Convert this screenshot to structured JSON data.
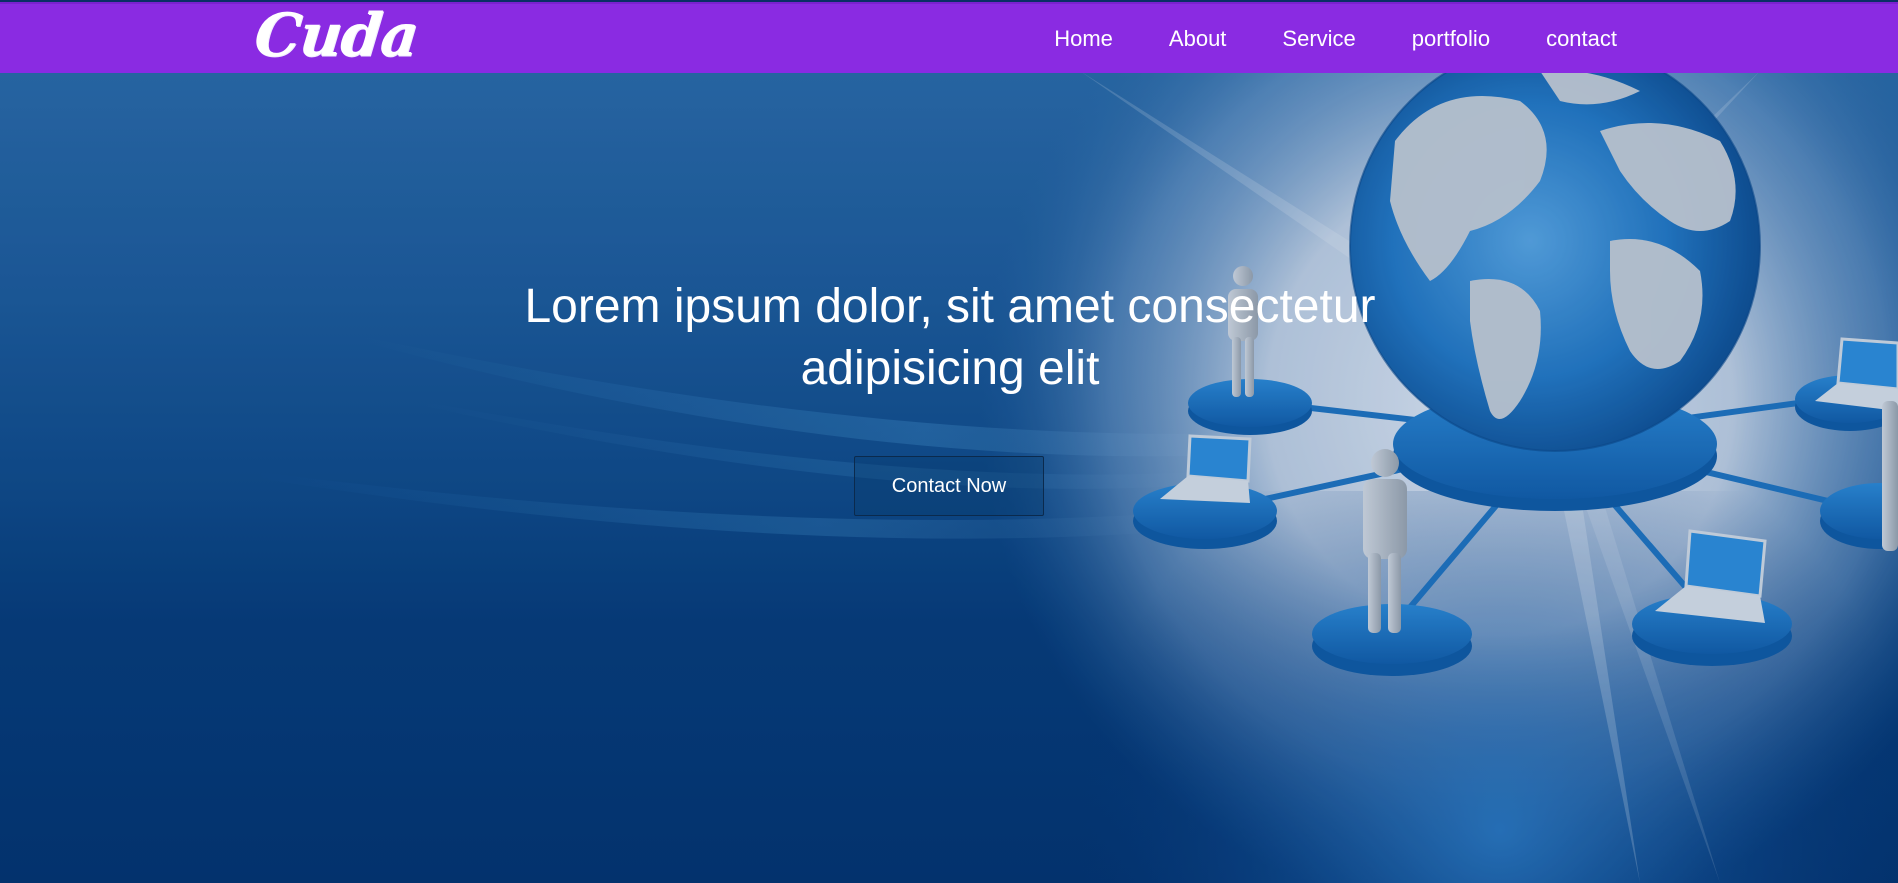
{
  "brand": {
    "logo_text": "Cuda"
  },
  "nav": {
    "items": [
      {
        "label": "Home"
      },
      {
        "label": "About"
      },
      {
        "label": "Service"
      },
      {
        "label": "portfolio"
      },
      {
        "label": "contact"
      }
    ]
  },
  "hero": {
    "title_line_1": "Lorem ipsum dolor, sit amet consectetur",
    "title_line_2": "adipisicing elit",
    "cta_label": "Contact Now",
    "image_semantic": "globe-network-illustration"
  },
  "colors": {
    "navbar": "#8a2be2",
    "hero_top": "#2b6aa6",
    "hero_bottom": "#03326c",
    "text": "#ffffff"
  }
}
